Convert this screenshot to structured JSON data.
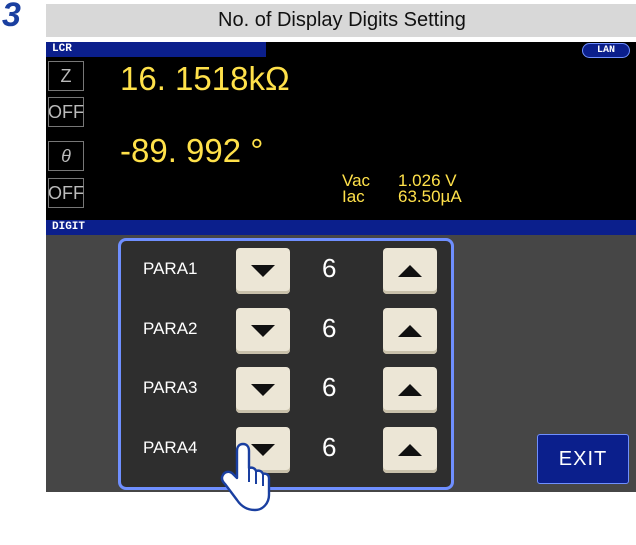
{
  "step": "3",
  "page_title": "No. of Display Digits Setting",
  "header": {
    "lcr_label": "LCR",
    "lan_badge": "LAN"
  },
  "side_buttons": {
    "param1": "Z",
    "off1": "OFF",
    "param2": "θ",
    "off2": "OFF"
  },
  "measurements": {
    "primary": "16. 1518kΩ",
    "secondary": "-89. 992  °",
    "vac_label": "Vac",
    "vac_value": "1.026 V",
    "iac_label": "Iac",
    "iac_value": "63.50µA"
  },
  "digit_section": {
    "label": "DIGIT",
    "rows": [
      {
        "label": "PARA1",
        "value": "6"
      },
      {
        "label": "PARA2",
        "value": "6"
      },
      {
        "label": "PARA3",
        "value": "6"
      },
      {
        "label": "PARA4",
        "value": "6"
      }
    ],
    "exit_label": "EXIT"
  },
  "colors": {
    "accent": "#0b1f8c",
    "value_yellow": "#ffe14a",
    "step_blue": "#1a3fa0",
    "panel_border": "#6f8fff"
  },
  "icons": {
    "down": "down-triangle-icon",
    "up": "up-triangle-icon",
    "pointer": "pointing-hand-icon"
  }
}
